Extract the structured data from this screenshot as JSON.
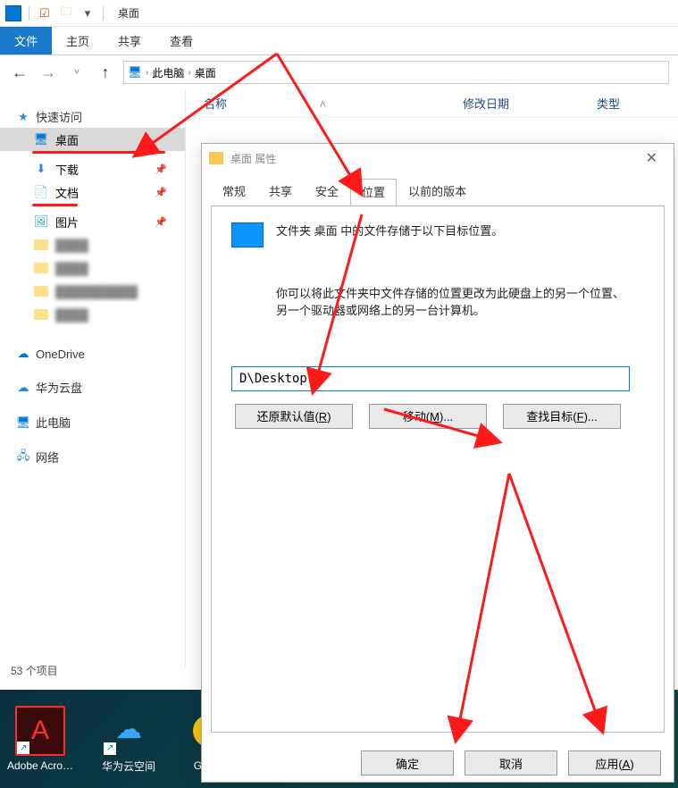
{
  "window": {
    "title": "桌面"
  },
  "ribbon": {
    "file": "文件",
    "tabs": [
      "主页",
      "共享",
      "查看"
    ]
  },
  "breadcrumb": {
    "pc": "此电脑",
    "desktop": "桌面"
  },
  "columns": {
    "name": "名称",
    "date": "修改日期",
    "type": "类型"
  },
  "sidebar": {
    "quick_access": "快速访问",
    "items": [
      {
        "label": "桌面",
        "icon": "desktop"
      },
      {
        "label": "下载",
        "icon": "download"
      },
      {
        "label": "文档",
        "icon": "document"
      },
      {
        "label": "图片",
        "icon": "pictures"
      }
    ],
    "onedrive": "OneDrive",
    "huawei": "华为云盘",
    "this_pc": "此电脑",
    "network": "网络"
  },
  "status": "53 个项目",
  "taskbar": {
    "items": [
      {
        "label": "Adobe Acro…"
      },
      {
        "label": "华为云空间"
      },
      {
        "label": "Goo…"
      }
    ]
  },
  "dialog": {
    "title": "桌面 属性",
    "tabs": {
      "general": "常规",
      "share": "共享",
      "security": "安全",
      "location": "位置",
      "previous": "以前的版本"
    },
    "desc_line": "文件夹 桌面 中的文件存储于以下目标位置。",
    "help_text": "你可以将此文件夹中文件存储的位置更改为此硬盘上的另一个位置、另一个驱动器或网络上的另一台计算机。",
    "path_value": "D\\Desktop",
    "buttons": {
      "restore": {
        "text": "还原默认值(",
        "key": "R",
        "suffix": ")"
      },
      "move": {
        "text": "移动(",
        "key": "M",
        "suffix": ")..."
      },
      "find": {
        "text": "查找目标(",
        "key": "F",
        "suffix": ")..."
      }
    },
    "footer": {
      "ok": "确定",
      "cancel": "取消",
      "apply": {
        "text": "应用(",
        "key": "A",
        "suffix": ")"
      }
    }
  }
}
